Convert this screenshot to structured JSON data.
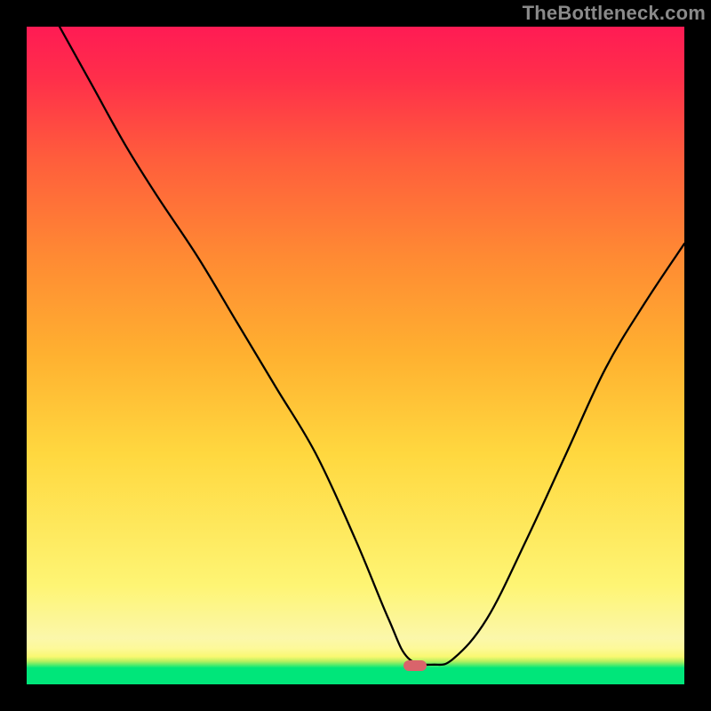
{
  "watermark": "TheBottleneck.com",
  "marker": {
    "x_pct": 59,
    "y_pct": 97.2
  },
  "chart_data": {
    "type": "line",
    "title": "",
    "xlabel": "",
    "ylabel": "",
    "xlim": [
      0,
      100
    ],
    "ylim": [
      0,
      100
    ],
    "grid": false,
    "legend": false,
    "series": [
      {
        "name": "bottleneck-curve",
        "x": [
          5,
          10,
          15,
          20,
          26,
          32,
          38,
          44,
          50,
          55,
          58,
          62,
          65,
          70,
          76,
          82,
          88,
          94,
          100
        ],
        "y": [
          100,
          91,
          82,
          74,
          65,
          55,
          45,
          35,
          22,
          10,
          4,
          3,
          4,
          10,
          22,
          35,
          48,
          58,
          67
        ]
      }
    ],
    "annotations": [
      {
        "type": "marker",
        "shape": "pill",
        "x": 59,
        "y": 2.8,
        "color": "#d9646b"
      }
    ]
  }
}
